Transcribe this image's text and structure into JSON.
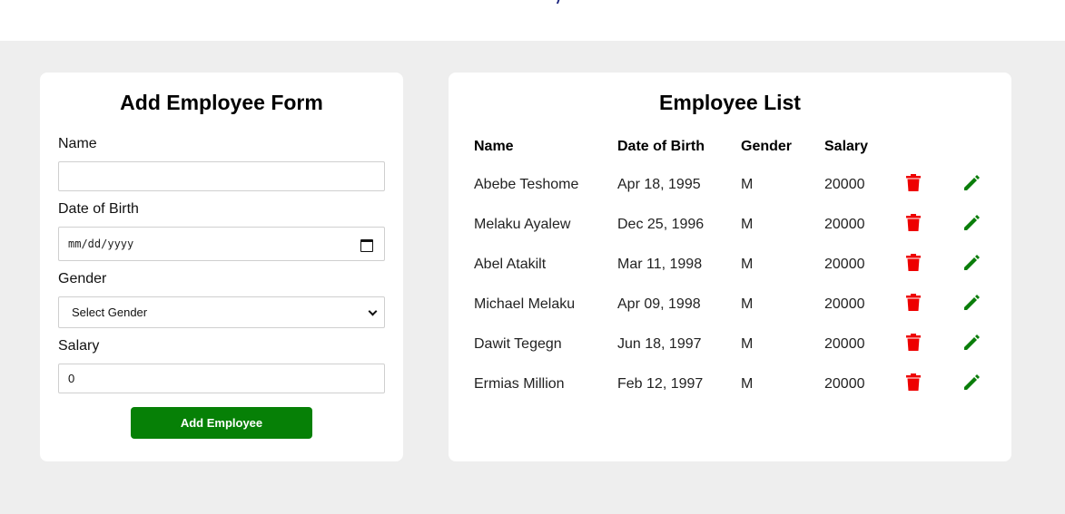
{
  "colors": {
    "page_bg": "#eeeeee",
    "card_bg": "#ffffff",
    "primary_button": "#068006",
    "delete_icon": "#ee0000",
    "edit_icon": "#0a7d0a"
  },
  "form": {
    "title": "Add Employee Form",
    "name_label": "Name",
    "name_value": "",
    "dob_label": "Date of Birth",
    "dob_placeholder": "mm/dd/yyyy",
    "gender_label": "Gender",
    "gender_selected": "Select Gender",
    "salary_label": "Salary",
    "salary_value": "0",
    "submit_label": "Add Employee"
  },
  "list": {
    "title": "Employee List",
    "columns": [
      "Name",
      "Date of Birth",
      "Gender",
      "Salary"
    ],
    "icons": {
      "delete": "trash-icon",
      "edit": "pencil-icon"
    },
    "rows": [
      {
        "name": "Abebe Teshome",
        "dob": "Apr 18, 1995",
        "gender": "M",
        "salary": "20000"
      },
      {
        "name": "Melaku Ayalew",
        "dob": "Dec 25, 1996",
        "gender": "M",
        "salary": "20000"
      },
      {
        "name": "Abel Atakilt",
        "dob": "Mar 11, 1998",
        "gender": "M",
        "salary": "20000"
      },
      {
        "name": "Michael Melaku",
        "dob": "Apr 09, 1998",
        "gender": "M",
        "salary": "20000"
      },
      {
        "name": "Dawit Tegegn",
        "dob": "Jun 18, 1997",
        "gender": "M",
        "salary": "20000"
      },
      {
        "name": "Ermias Million",
        "dob": "Feb 12, 1997",
        "gender": "M",
        "salary": "20000"
      }
    ]
  }
}
